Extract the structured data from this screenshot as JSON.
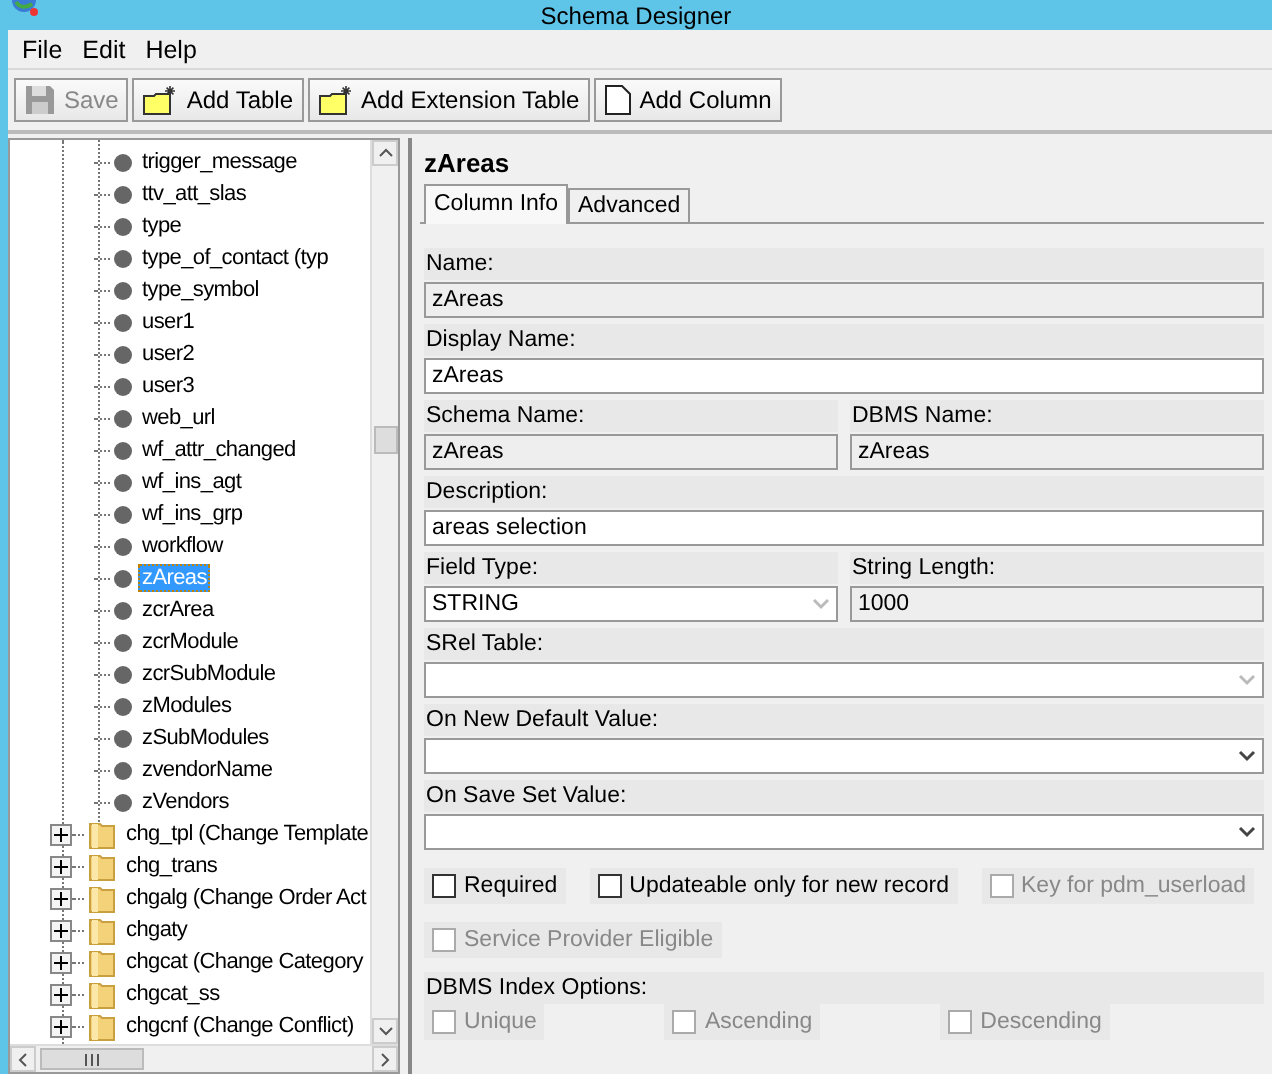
{
  "window": {
    "title": "Schema Designer"
  },
  "menu": [
    "File",
    "Edit",
    "Help"
  ],
  "toolbar": [
    {
      "label": "Save",
      "disabled": true
    },
    {
      "label": "Add Table",
      "disabled": false
    },
    {
      "label": "Add Extension Table",
      "disabled": false
    },
    {
      "label": "Add Column",
      "disabled": false
    }
  ],
  "tree": [
    {
      "kind": "column",
      "label": "trigger_message",
      "selected": false
    },
    {
      "kind": "column",
      "label": "ttv_att_slas",
      "selected": false
    },
    {
      "kind": "column",
      "label": "type",
      "selected": false
    },
    {
      "kind": "column",
      "label": "type_of_contact (typ",
      "selected": false
    },
    {
      "kind": "column",
      "label": "type_symbol",
      "selected": false
    },
    {
      "kind": "column",
      "label": "user1",
      "selected": false
    },
    {
      "kind": "column",
      "label": "user2",
      "selected": false
    },
    {
      "kind": "column",
      "label": "user3",
      "selected": false
    },
    {
      "kind": "column",
      "label": "web_url",
      "selected": false
    },
    {
      "kind": "column",
      "label": "wf_attr_changed",
      "selected": false
    },
    {
      "kind": "column",
      "label": "wf_ins_agt",
      "selected": false
    },
    {
      "kind": "column",
      "label": "wf_ins_grp",
      "selected": false
    },
    {
      "kind": "column",
      "label": "workflow",
      "selected": false
    },
    {
      "kind": "column",
      "label": "zAreas",
      "selected": true
    },
    {
      "kind": "column",
      "label": "zcrArea",
      "selected": false
    },
    {
      "kind": "column",
      "label": "zcrModule",
      "selected": false
    },
    {
      "kind": "column",
      "label": "zcrSubModule",
      "selected": false
    },
    {
      "kind": "column",
      "label": "zModules",
      "selected": false
    },
    {
      "kind": "column",
      "label": "zSubModules",
      "selected": false
    },
    {
      "kind": "column",
      "label": "zvendorName",
      "selected": false
    },
    {
      "kind": "column",
      "label": "zVendors",
      "selected": false
    },
    {
      "kind": "table",
      "label": "chg_tpl (Change Template",
      "expanded": false,
      "selected": false
    },
    {
      "kind": "table",
      "label": "chg_trans",
      "expanded": false,
      "selected": false
    },
    {
      "kind": "table",
      "label": "chgalg (Change Order Act",
      "expanded": false,
      "selected": false
    },
    {
      "kind": "table",
      "label": "chgaty",
      "expanded": false,
      "selected": false
    },
    {
      "kind": "table",
      "label": "chgcat (Change Category",
      "expanded": false,
      "selected": false
    },
    {
      "kind": "table",
      "label": "chgcat_ss",
      "expanded": false,
      "selected": false
    },
    {
      "kind": "table",
      "label": "chgcnf (Change Conflict)",
      "expanded": false,
      "selected": false
    }
  ],
  "detail": {
    "title": "zAreas",
    "tabs": [
      {
        "label": "Column Info",
        "selected": true
      },
      {
        "label": "Advanced",
        "selected": false
      }
    ],
    "rows": [
      [
        {
          "label": "Name:",
          "kind": "readonly",
          "value": "zAreas"
        }
      ],
      [
        {
          "label": "Display Name:",
          "kind": "text",
          "value": "zAreas"
        }
      ],
      [
        {
          "label": "Schema Name:",
          "kind": "readonly",
          "value": "zAreas"
        },
        {
          "label": "DBMS Name:",
          "kind": "readonly",
          "value": "zAreas"
        }
      ],
      [
        {
          "label": "Description:",
          "kind": "text",
          "value": "areas selection"
        }
      ],
      [
        {
          "label": "Field Type:",
          "kind": "select",
          "value": "STRING",
          "disabled": true
        },
        {
          "label": "String Length:",
          "kind": "readonly",
          "value": "1000"
        }
      ],
      [
        {
          "label": "SRel Table:",
          "kind": "select",
          "disabled": true
        }
      ],
      [
        {
          "label": "On New Default Value:",
          "kind": "select",
          "disabled": false
        }
      ],
      [
        {
          "label": "On Save Set Value:",
          "kind": "select",
          "disabled": false
        }
      ]
    ],
    "checkbox_rows": [
      [
        {
          "label": "Required",
          "checked": false,
          "disabled": false
        },
        {
          "label": "Updateable only for new record",
          "checked": false,
          "disabled": false
        },
        {
          "label": "Key for pdm_userload",
          "checked": false,
          "disabled": true
        }
      ],
      [
        {
          "label": "Service Provider Eligible",
          "checked": false,
          "disabled": true
        }
      ]
    ],
    "index_options": {
      "label": "DBMS Index Options:",
      "options": [
        {
          "label": "Unique",
          "checked": false,
          "disabled": true
        },
        {
          "label": "Ascending",
          "checked": false,
          "disabled": true
        },
        {
          "label": "Descending",
          "checked": false,
          "disabled": true
        }
      ]
    }
  }
}
